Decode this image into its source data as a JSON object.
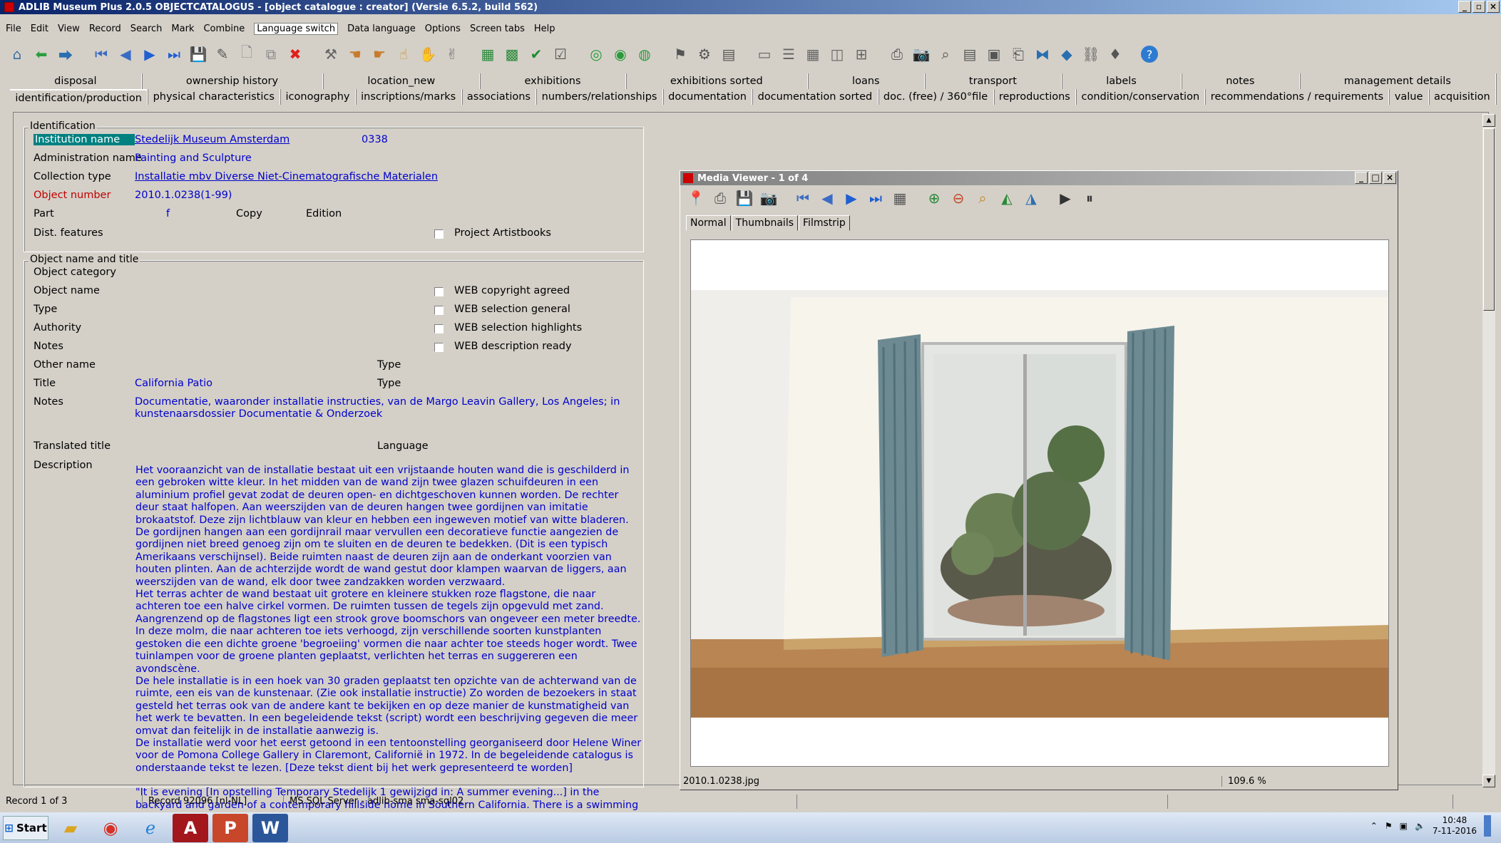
{
  "window": {
    "title": "ADLIB Museum Plus 2.0.5 OBJECTCATALOGUS - [object catalogue : creator] (Versie 6.5.2, build 562)"
  },
  "menu": [
    "File",
    "Edit",
    "View",
    "Record",
    "Search",
    "Mark",
    "Combine",
    "Language switch",
    "Data language",
    "Options",
    "Screen tabs",
    "Help"
  ],
  "tabs_row1": [
    "disposal",
    "ownership history",
    "location_new",
    "exhibitions",
    "exhibitions sorted",
    "loans",
    "transport",
    "labels",
    "notes",
    "management details"
  ],
  "tabs_row2": [
    "identification/production",
    "physical characteristics",
    "iconography",
    "inscriptions/marks",
    "associations",
    "numbers/relationships",
    "documentation",
    "documentation sorted",
    "doc. (free) / 360°file",
    "reproductions",
    "condition/conservation",
    "recommendations / requirements",
    "value",
    "acquisition"
  ],
  "identification": {
    "group_title": "Identification",
    "institution_label": "Institution name",
    "institution_value": "Stedelijk Museum Amsterdam",
    "institution_code": "0338",
    "admin_label": "Administration name",
    "admin_value": "Painting and Sculpture",
    "collection_label": "Collection type",
    "collection_value": "Installatie mbv Diverse Niet-Cinematografische Materialen",
    "object_number_label": "Object number",
    "object_number_value": "2010.1.0238(1-99)",
    "part_label": "Part",
    "part_value": "f",
    "copy_label": "Copy",
    "edition_label": "Edition",
    "dist_label": "Dist. features",
    "artistbooks_label": "Project Artistbooks"
  },
  "object_name": {
    "group_title": "Object name and title",
    "category_label": "Object category",
    "name_label": "Object name",
    "type_label": "Type",
    "authority_label": "Authority",
    "notes_label": "Notes",
    "web_copyright": "WEB copyright agreed",
    "web_selection_general": "WEB selection general",
    "web_selection_highlights": "WEB selection highlights",
    "web_description_ready": "WEB description ready",
    "other_name_label": "Other name",
    "other_type_label": "Type",
    "title_label": "Title",
    "title_value": "California Patio",
    "title_type_label": "Type",
    "title_notes_label": "Notes",
    "title_notes_value_1": "Documentatie, waaronder installatie instructies, van de Margo Leavin Gallery, Los Angeles; in",
    "title_notes_value_2": "kunstenaarsdossier Documentatie & Onderzoek",
    "translated_label": "Translated title",
    "language_label": "Language",
    "description_label": "Description"
  },
  "description": {
    "p1": "Het vooraanzicht van de installatie bestaat uit een vrijstaande houten wand die is geschilderd in een gebroken witte kleur. In het midden van de wand zijn twee glazen schuifdeuren in een aluminium profiel gevat zodat de deuren open- en dichtgeschoven kunnen worden. De rechter deur staat halfopen. Aan weerszijden van de deuren hangen twee gordijnen van imitatie brokaatstof. Deze zijn lichtblauw van kleur en hebben een ingeweven motief van witte bladeren. De gordijnen hangen aan een gordijnrail maar vervullen een decoratieve functie aangezien de gordijnen niet breed genoeg zijn om te sluiten en de deuren te bedekken. (Dit is een typisch Amerikaans verschijnsel). Beide ruimten naast de deuren zijn aan de onderkant voorzien van houten plinten. Aan de achterzijde wordt de wand gestut door klampen waarvan de liggers, aan weerszijden van de wand, elk door twee zandzakken worden verzwaard.",
    "p2": "Het terras achter de wand bestaat uit grotere en kleinere stukken roze flagstone, die naar achteren toe een halve cirkel vormen. De ruimten tussen de tegels zijn opgevuld met zand. Aangrenzend op de flagstones ligt een strook grove boomschors van ongeveer een meter breedte. In deze molm, die naar achteren toe iets verhoogd, zijn verschillende soorten kunstplanten gestoken die een dichte groene 'begroeiing' vormen die naar achter toe steeds hoger wordt. Twee tuinlampen voor de groene planten geplaatst, verlichten het terras en suggereren een avondscène.",
    "p3": "De hele installatie is in een hoek van 30 graden geplaatst ten opzichte van de achterwand van de ruimte, een eis van de kunstenaar. (Zie ook installatie instructie) Zo worden de bezoekers in staat gesteld het terras ook van de andere kant te bekijken en op deze manier de kunstmatigheid van het werk te bevatten. In een begeleidende tekst (script) wordt een beschrijving gegeven die meer omvat dan feitelijk in de installatie aanwezig is.",
    "p4": "De installatie werd voor het eerst getoond in een tentoonstelling georganiseerd door Helene Winer voor de Pomona College Gallery in Claremont, Californië in 1972. In de begeleidende catalogus is onderstaande tekst te lezen. [Deze tekst dient bij het werk gepresenteerd te worden]",
    "p5": "\"It is evening [In opstelling Temporary Stedelijk 1 gewijzigd in: A summer evening...] in the backyard and garden of a contemporary hillside home in Southern California. There is a swimming pool, a flagstone patio, a"
  },
  "media_viewer": {
    "title": "Media Viewer - 1 of 4",
    "tabs": [
      "Normal",
      "Thumbnails",
      "Filmstrip"
    ],
    "filename": "2010.1.0238.jpg",
    "zoom": "109.6 %"
  },
  "status": {
    "record": "Record 1 of 3",
    "record_id": "Record 92096 [nl-NL]",
    "server": "MS SQL Server - adlib-sma sma-sql02"
  },
  "taskbar": {
    "start": "Start",
    "time": "10:48",
    "date": "7-11-2016"
  },
  "colors": {
    "title_blue": "#0a246a",
    "field_blue": "#0000cc",
    "required_red": "#c00000",
    "highlight_teal": "#008080"
  }
}
